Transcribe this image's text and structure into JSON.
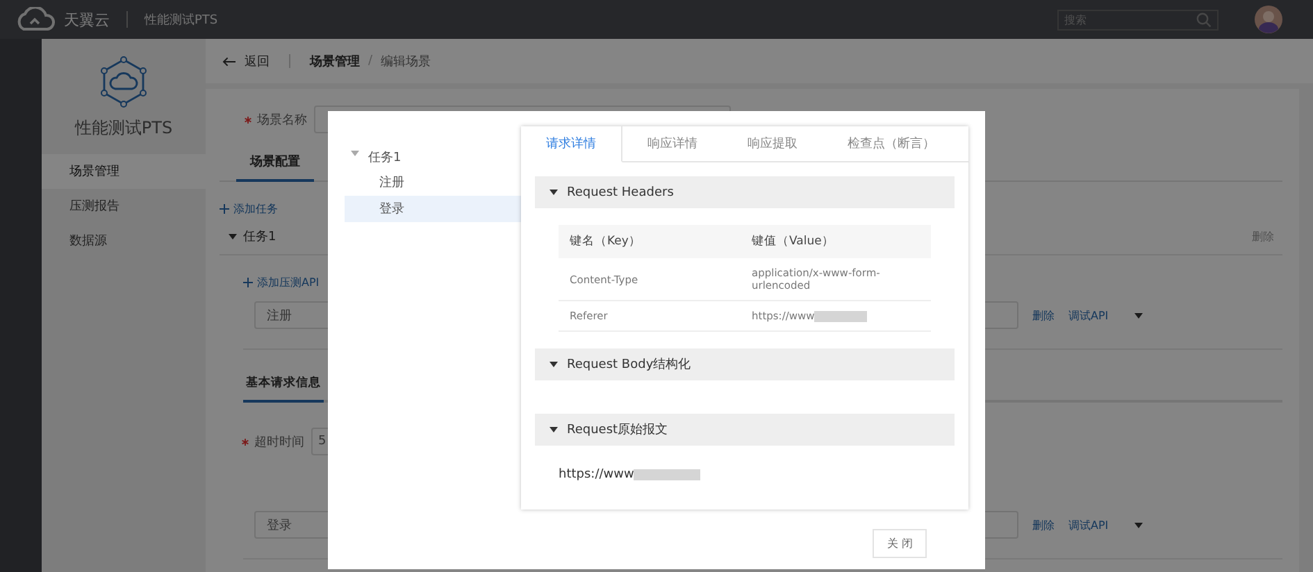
{
  "header": {
    "brand": "天翼云",
    "product": "性能测试PTS",
    "search": {
      "placeholder": "搜索"
    }
  },
  "sidebar": {
    "title": "性能测试PTS",
    "items": [
      {
        "label": "场景管理",
        "selected": true
      },
      {
        "label": "压测报告",
        "selected": false
      },
      {
        "label": "数据源",
        "selected": false
      }
    ]
  },
  "breadcrumb": {
    "back": "返回",
    "separator": "/",
    "items": [
      "场景管理",
      "编辑场景"
    ]
  },
  "scene_name": {
    "label": "场景名称",
    "required": true
  },
  "tabs": [
    {
      "label": "场景配置",
      "selected": true
    }
  ],
  "add_task": "添加任务",
  "task": {
    "name": "任务1",
    "expanded": true,
    "delete": "删除",
    "add_api": "添加压测API",
    "apis": [
      {
        "name": "注册",
        "delete": "删除",
        "debug": "调试API",
        "details": {
          "tabs": [
            {
              "label": "基本请求信息",
              "selected": true
            }
          ],
          "timeout": {
            "label": "超时时间",
            "required": true,
            "value": "5"
          }
        }
      },
      {
        "name": "登录",
        "delete": "删除",
        "debug": "调试API"
      }
    ]
  },
  "dialog": {
    "tree": [
      {
        "label": "任务1",
        "expanded": true,
        "children": [
          {
            "label": "注册",
            "selected": false
          },
          {
            "label": "登录",
            "selected": true
          }
        ]
      }
    ],
    "tabs": [
      {
        "label": "请求详情",
        "selected": true
      },
      {
        "label": "响应详情",
        "selected": false
      },
      {
        "label": "响应提取",
        "selected": false
      },
      {
        "label": "检查点（断言）",
        "selected": false
      }
    ],
    "sections": [
      {
        "title": "Request Headers",
        "expanded": true,
        "table": {
          "columns": [
            "键名（Key）",
            "键值（Value）"
          ],
          "rows": [
            {
              "key": "Content-Type",
              "value": "application/x-www-form-urlencoded",
              "redacted": false
            },
            {
              "key": "Referer",
              "value": "https://www",
              "redacted": true
            }
          ]
        }
      },
      {
        "title": "Request Body结构化",
        "expanded": true
      },
      {
        "title": "Request原始报文",
        "expanded": true,
        "text": "https://www",
        "redacted": true
      }
    ],
    "close": "关 闭"
  }
}
